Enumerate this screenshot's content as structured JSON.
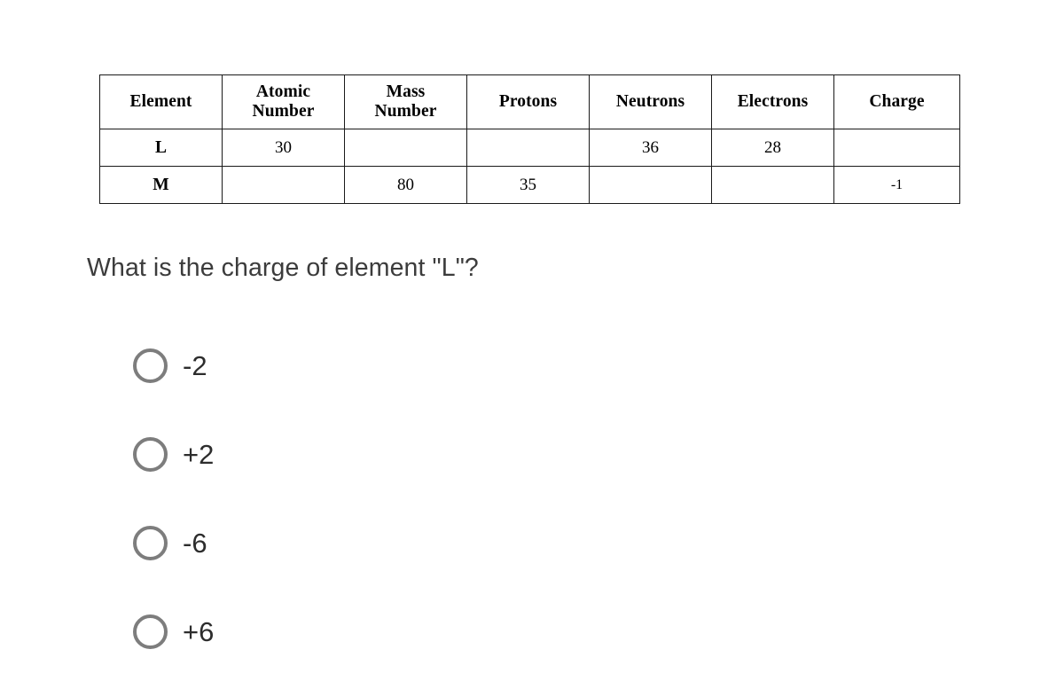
{
  "table": {
    "headers": [
      "Element",
      [
        "Atomic",
        "Number"
      ],
      [
        "Mass",
        "Number"
      ],
      "Protons",
      "Neutrons",
      "Electrons",
      "Charge"
    ],
    "rows": [
      {
        "element": "L",
        "atomic_number": "30",
        "mass_number": "",
        "protons": "",
        "neutrons": "36",
        "electrons": "28",
        "charge": ""
      },
      {
        "element": "M",
        "atomic_number": "",
        "mass_number": "80",
        "protons": "35",
        "neutrons": "",
        "electrons": "",
        "charge": "-1"
      }
    ]
  },
  "question": {
    "text": "What is the charge of element \"L\"?"
  },
  "options": [
    {
      "label": "-2"
    },
    {
      "label": "+2"
    },
    {
      "label": "-6"
    },
    {
      "label": "+6"
    }
  ],
  "colors": {
    "background": "#ffffff",
    "table_border": "#1a1a1a",
    "table_text": "#000000",
    "question_text": "#3c3c3c",
    "option_text": "#2d2d2d",
    "radio_ring": "#7d7d7d"
  }
}
